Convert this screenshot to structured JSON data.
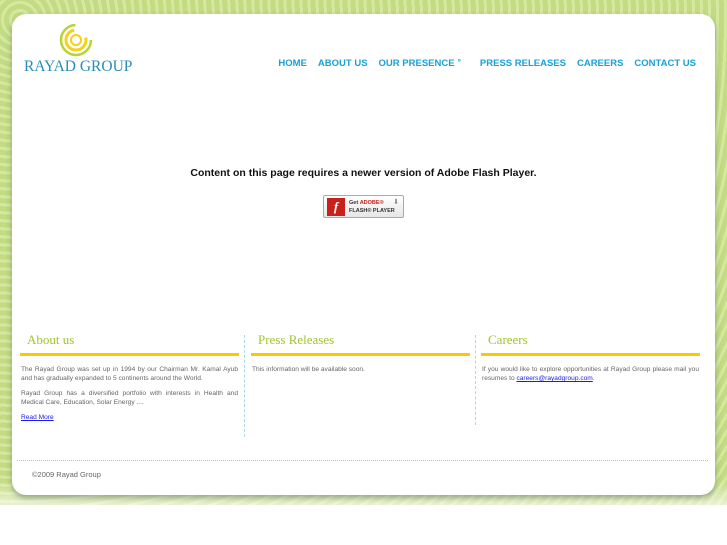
{
  "logo": {
    "text": "RAYAD GROUP"
  },
  "nav": {
    "items": [
      "HOME",
      "ABOUT US",
      "OUR PRESENCE",
      "PRESS RELEASES",
      "CAREERS",
      "CONTACT US"
    ],
    "presence_marker": "»"
  },
  "flash": {
    "message": "Content on this page requires a newer version of Adobe Flash Player.",
    "button_get": "Get",
    "button_adobe": "ADOBE®",
    "button_product": "FLASH® PLAYER"
  },
  "about": {
    "title": "About us",
    "p1": "The Rayad Group was set up in 1994 by our Chairman Mr. Kamal Ayub and has gradually expanded to 5 continents around the World.",
    "p2": "Rayad Group has a diversified portfolio with interests in Health and Medical Care, Education, Solar Energy ....",
    "link": "Read More"
  },
  "press": {
    "title": "Press Releases",
    "text": "This information will be available soon."
  },
  "careers": {
    "title": "Careers",
    "text": "If you would like to explore opportunities at Rayad Group please mail you resumes to ",
    "email": "careers@rayadgroup.com",
    "end": "."
  },
  "footer": {
    "copyright": "©2009 Rayad Group"
  },
  "colors": {
    "nav": "#1aa0d5",
    "heading": "#9cc630",
    "bar": "#fcc800"
  }
}
